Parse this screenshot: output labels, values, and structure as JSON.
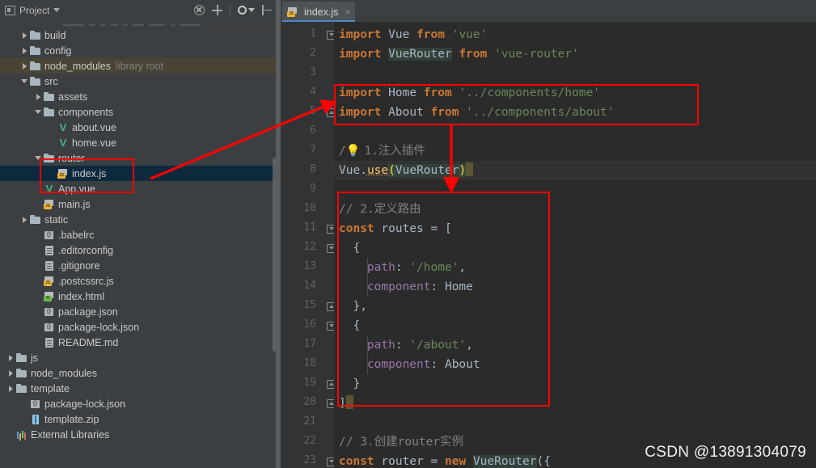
{
  "toolwindow": {
    "title": "Project",
    "dropdown_caret": "caret-down-icon",
    "actions": [
      {
        "name": "collapse-all-icon",
        "label": "Collapse All"
      },
      {
        "name": "expand-locate-icon",
        "label": "Select Opened File"
      },
      {
        "name": "settings-gear-icon",
        "label": "Settings"
      },
      {
        "name": "hide-panel-icon",
        "label": "Hide"
      }
    ]
  },
  "tree": [
    {
      "label": "build",
      "icon": "folder-icon",
      "arrow": "right",
      "indent": 1,
      "state": "normal"
    },
    {
      "label": "config",
      "icon": "folder-icon",
      "arrow": "right",
      "indent": 1,
      "state": "normal"
    },
    {
      "label": "node_modules",
      "icon": "folder-icon",
      "arrow": "right",
      "indent": 1,
      "state": "module",
      "sublabel": "library root"
    },
    {
      "label": "src",
      "icon": "folder-icon",
      "arrow": "down",
      "indent": 1,
      "state": "normal"
    },
    {
      "label": "assets",
      "icon": "folder-icon",
      "arrow": "right",
      "indent": 2,
      "state": "normal"
    },
    {
      "label": "components",
      "icon": "folder-icon",
      "arrow": "down",
      "indent": 2,
      "state": "normal"
    },
    {
      "label": "about.vue",
      "icon": "vue-file-icon",
      "arrow": "none",
      "indent": 3,
      "state": "normal"
    },
    {
      "label": "home.vue",
      "icon": "vue-file-icon",
      "arrow": "none",
      "indent": 3,
      "state": "normal"
    },
    {
      "label": "router",
      "icon": "folder-icon",
      "arrow": "down",
      "indent": 2,
      "state": "normal"
    },
    {
      "label": "index.js",
      "icon": "js-file-icon",
      "arrow": "none",
      "indent": 3,
      "state": "selected"
    },
    {
      "label": "App.vue",
      "icon": "vue-file-icon",
      "arrow": "none",
      "indent": 2,
      "state": "normal"
    },
    {
      "label": "main.js",
      "icon": "js-file-icon",
      "arrow": "none",
      "indent": 2,
      "state": "normal"
    },
    {
      "label": "static",
      "icon": "folder-icon",
      "arrow": "right",
      "indent": 1,
      "state": "normal"
    },
    {
      "label": ".babelrc",
      "icon": "json-file-icon",
      "arrow": "none",
      "indent": 2,
      "state": "normal"
    },
    {
      "label": ".editorconfig",
      "icon": "text-file-icon",
      "arrow": "none",
      "indent": 2,
      "state": "normal"
    },
    {
      "label": ".gitignore",
      "icon": "text-file-icon",
      "arrow": "none",
      "indent": 2,
      "state": "normal"
    },
    {
      "label": ".postcssrc.js",
      "icon": "js-file-icon",
      "arrow": "none",
      "indent": 2,
      "state": "normal"
    },
    {
      "label": "index.html",
      "icon": "html-file-icon",
      "arrow": "none",
      "indent": 2,
      "state": "normal"
    },
    {
      "label": "package.json",
      "icon": "json-file-icon",
      "arrow": "none",
      "indent": 2,
      "state": "normal"
    },
    {
      "label": "package-lock.json",
      "icon": "json-file-icon",
      "arrow": "none",
      "indent": 2,
      "state": "normal"
    },
    {
      "label": "README.md",
      "icon": "text-file-icon",
      "arrow": "none",
      "indent": 2,
      "state": "normal"
    },
    {
      "label": "js",
      "icon": "folder-icon",
      "arrow": "right",
      "indent": 0,
      "state": "normal"
    },
    {
      "label": "node_modules",
      "icon": "folder-icon",
      "arrow": "right",
      "indent": 0,
      "state": "normal"
    },
    {
      "label": "template",
      "icon": "folder-icon",
      "arrow": "right",
      "indent": 0,
      "state": "normal"
    },
    {
      "label": "package-lock.json",
      "icon": "json-file-icon",
      "arrow": "none",
      "indent": 1,
      "state": "normal"
    },
    {
      "label": "template.zip",
      "icon": "zip-file-icon",
      "arrow": "none",
      "indent": 1,
      "state": "normal"
    },
    {
      "label": "External Libraries",
      "icon": "libraries-icon",
      "arrow": "none",
      "indent": 0,
      "state": "normal"
    }
  ],
  "editor": {
    "tab": {
      "label": "index.js",
      "icon": "js-file-icon",
      "close": "×"
    },
    "lines": [
      {
        "n": 1,
        "fold": "open",
        "text": "import Vue from 'vue'"
      },
      {
        "n": 2,
        "fold": "none",
        "text": "import VueRouter from 'vue-router'"
      },
      {
        "n": 3,
        "fold": "none",
        "text": ""
      },
      {
        "n": 4,
        "fold": "none",
        "text": "import Home from '../components/home'"
      },
      {
        "n": 5,
        "fold": "end",
        "text": "import About from '../components/about'"
      },
      {
        "n": 6,
        "fold": "none",
        "text": ""
      },
      {
        "n": 7,
        "fold": "none",
        "text": "// 1.注入插件"
      },
      {
        "n": 8,
        "fold": "none",
        "text": "Vue.use(VueRouter)"
      },
      {
        "n": 9,
        "fold": "none",
        "text": ""
      },
      {
        "n": 10,
        "fold": "none",
        "text": "// 2.定义路由"
      },
      {
        "n": 11,
        "fold": "open",
        "text": "const routes = ["
      },
      {
        "n": 12,
        "fold": "open",
        "text": "  {"
      },
      {
        "n": 13,
        "fold": "none",
        "text": "    path: '/home',"
      },
      {
        "n": 14,
        "fold": "none",
        "text": "    component: Home"
      },
      {
        "n": 15,
        "fold": "end",
        "text": "  },"
      },
      {
        "n": 16,
        "fold": "open",
        "text": "  {"
      },
      {
        "n": 17,
        "fold": "none",
        "text": "    path: '/about',"
      },
      {
        "n": 18,
        "fold": "none",
        "text": "    component: About"
      },
      {
        "n": 19,
        "fold": "end",
        "text": "  }"
      },
      {
        "n": 20,
        "fold": "end",
        "text": "]"
      },
      {
        "n": 21,
        "fold": "none",
        "text": ""
      },
      {
        "n": 22,
        "fold": "none",
        "text": "// 3.创建router实例"
      },
      {
        "n": 23,
        "fold": "open",
        "text": "const router = new VueRouter({"
      }
    ],
    "highlighted_line": 8,
    "intention_bulb": "lightbulb-icon"
  },
  "annotations": {
    "box1_label": "imports-highlight-box",
    "box2_label": "routes-highlight-box",
    "box3_label": "router-folder-highlight-box",
    "arrow1_label": "arrow-router-to-imports",
    "arrow2_label": "arrow-down-to-routes",
    "color": "#ff0000"
  },
  "watermark": {
    "text": "CSDN @13891304079"
  }
}
